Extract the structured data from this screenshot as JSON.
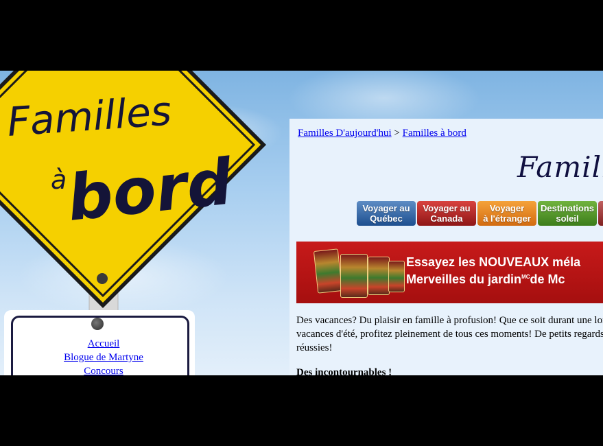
{
  "sign": {
    "line1": "Familles",
    "line2": "à",
    "line3": "bord"
  },
  "side_nav": {
    "items": [
      {
        "label": "Accueil"
      },
      {
        "label": "Blogue de Martyne"
      },
      {
        "label": "Concours"
      }
    ]
  },
  "breadcrumb": {
    "home": "Familles D'aujourd'hui",
    "separator": ">",
    "current": "Familles à bord"
  },
  "header": {
    "title": "Famille"
  },
  "tabs": [
    {
      "line1": "Voyager au",
      "line2": "Québec"
    },
    {
      "line1": "Voyager au",
      "line2": "Canada"
    },
    {
      "line1": "Voyager",
      "line2": "à l'étranger"
    },
    {
      "line1": "Destinations",
      "line2": "soleil"
    }
  ],
  "banner": {
    "line1": "Essayez les NOUVEAUX méla",
    "line2_a": "Merveilles du jardin",
    "line2_sup": "MC",
    "line2_b": "de Mc"
  },
  "intro": {
    "line1": "Des vacances? Du plaisir en famille à profusion! Que ce soit durant une lon",
    "line2": "vacances d'été, profitez pleinement de tous ces moments! De petits regards",
    "line3": "réussies!"
  },
  "section": {
    "heading": "Des incontournables !"
  },
  "colors": {
    "sign_yellow": "#f5d000",
    "sign_text": "#141438",
    "link": "#0000ee",
    "banner_red": "#c71a1a"
  }
}
